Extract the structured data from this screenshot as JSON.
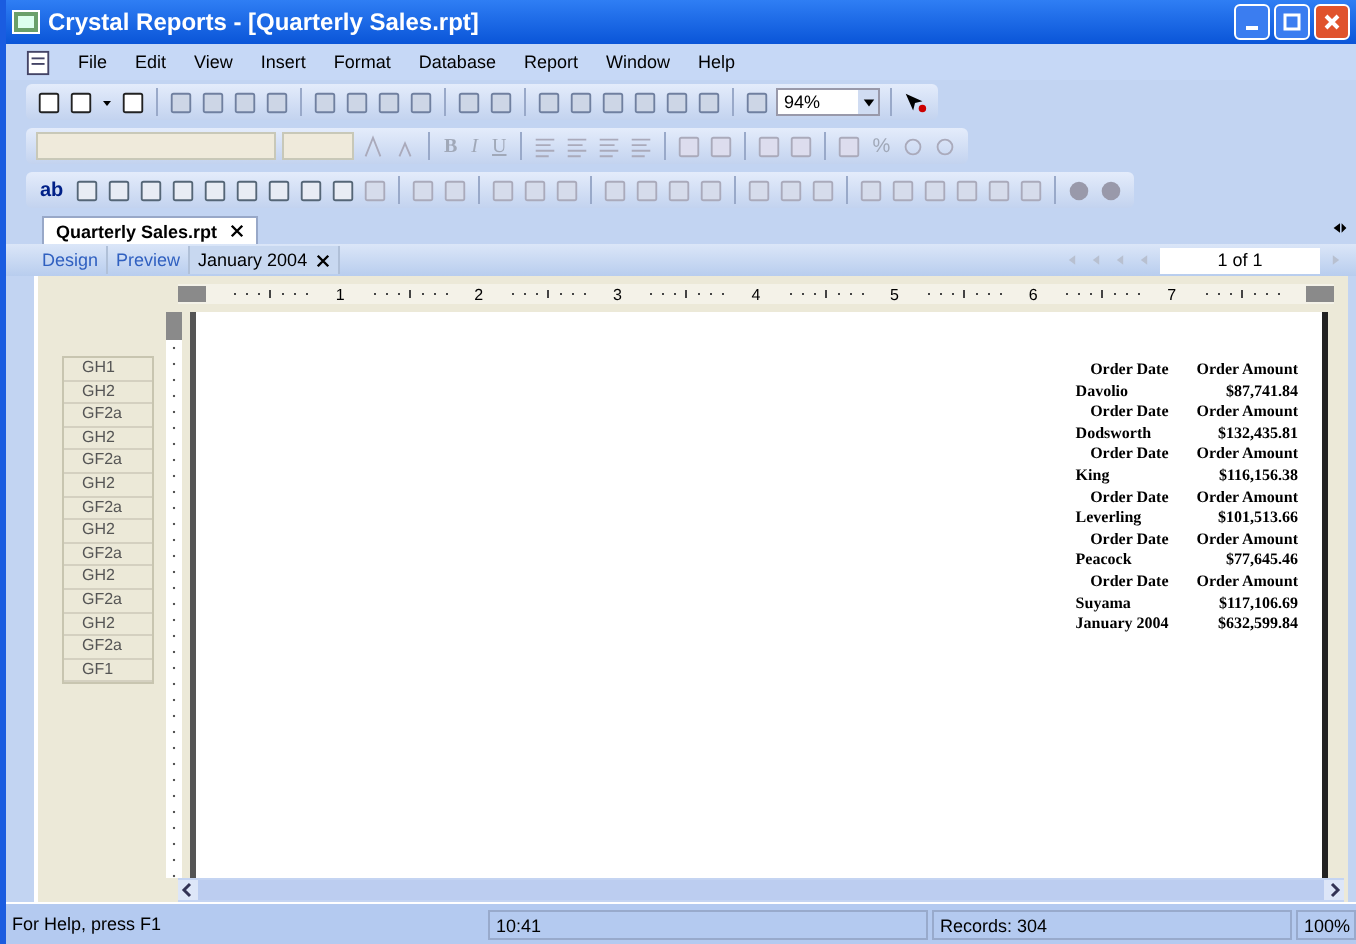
{
  "window": {
    "title": "Crystal Reports - [Quarterly Sales.rpt]"
  },
  "menu": [
    "File",
    "Edit",
    "View",
    "Insert",
    "Format",
    "Database",
    "Report",
    "Window",
    "Help"
  ],
  "toolbar": {
    "zoom": "94%"
  },
  "format_toolbar": {
    "bold": "B",
    "italic": "I",
    "underline": "U",
    "percent": "%"
  },
  "insert_toolbar": {
    "text_object": "ab"
  },
  "document_tabs": [
    {
      "label": "Quarterly Sales.rpt",
      "selected": true
    }
  ],
  "view_tabs": [
    {
      "label": "Design",
      "selected": false
    },
    {
      "label": "Preview",
      "selected": false
    },
    {
      "label": "January 2004",
      "selected": true
    }
  ],
  "page_indicator": "1 of 1",
  "ruler": [
    "1",
    "2",
    "3",
    "4",
    "5",
    "6",
    "7"
  ],
  "sections": [
    "GH1",
    "GH2",
    "GF2a",
    "GH2",
    "GF2a",
    "GH2",
    "GF2a",
    "GH2",
    "GF2a",
    "GH2",
    "GF2a",
    "GH2",
    "GF2a",
    "GF1"
  ],
  "report": {
    "groups": [
      {
        "col1": "Order Date",
        "col2": "Order Amount",
        "name": "Davolio",
        "amount": "$87,741.84"
      },
      {
        "col1": "Order Date",
        "col2": "Order Amount",
        "name": "Dodsworth",
        "amount": "$132,435.81"
      },
      {
        "col1": "Order Date",
        "col2": "Order Amount",
        "name": "King",
        "amount": "$116,156.38"
      },
      {
        "col1": "Order Date",
        "col2": "Order Amount",
        "name": "Leverling",
        "amount": "$101,513.66"
      },
      {
        "col1": "Order Date",
        "col2": "Order Amount",
        "name": "Peacock",
        "amount": "$77,645.46"
      },
      {
        "col1": "Order Date",
        "col2": "Order Amount",
        "name": "Suyama",
        "amount": "$117,106.69"
      }
    ],
    "total": {
      "label": "January 2004",
      "amount": "$632,599.84"
    }
  },
  "status_bar": {
    "help": "For Help, press F1",
    "time": "10:41",
    "records": "Records:  304",
    "zoom": "100%"
  }
}
